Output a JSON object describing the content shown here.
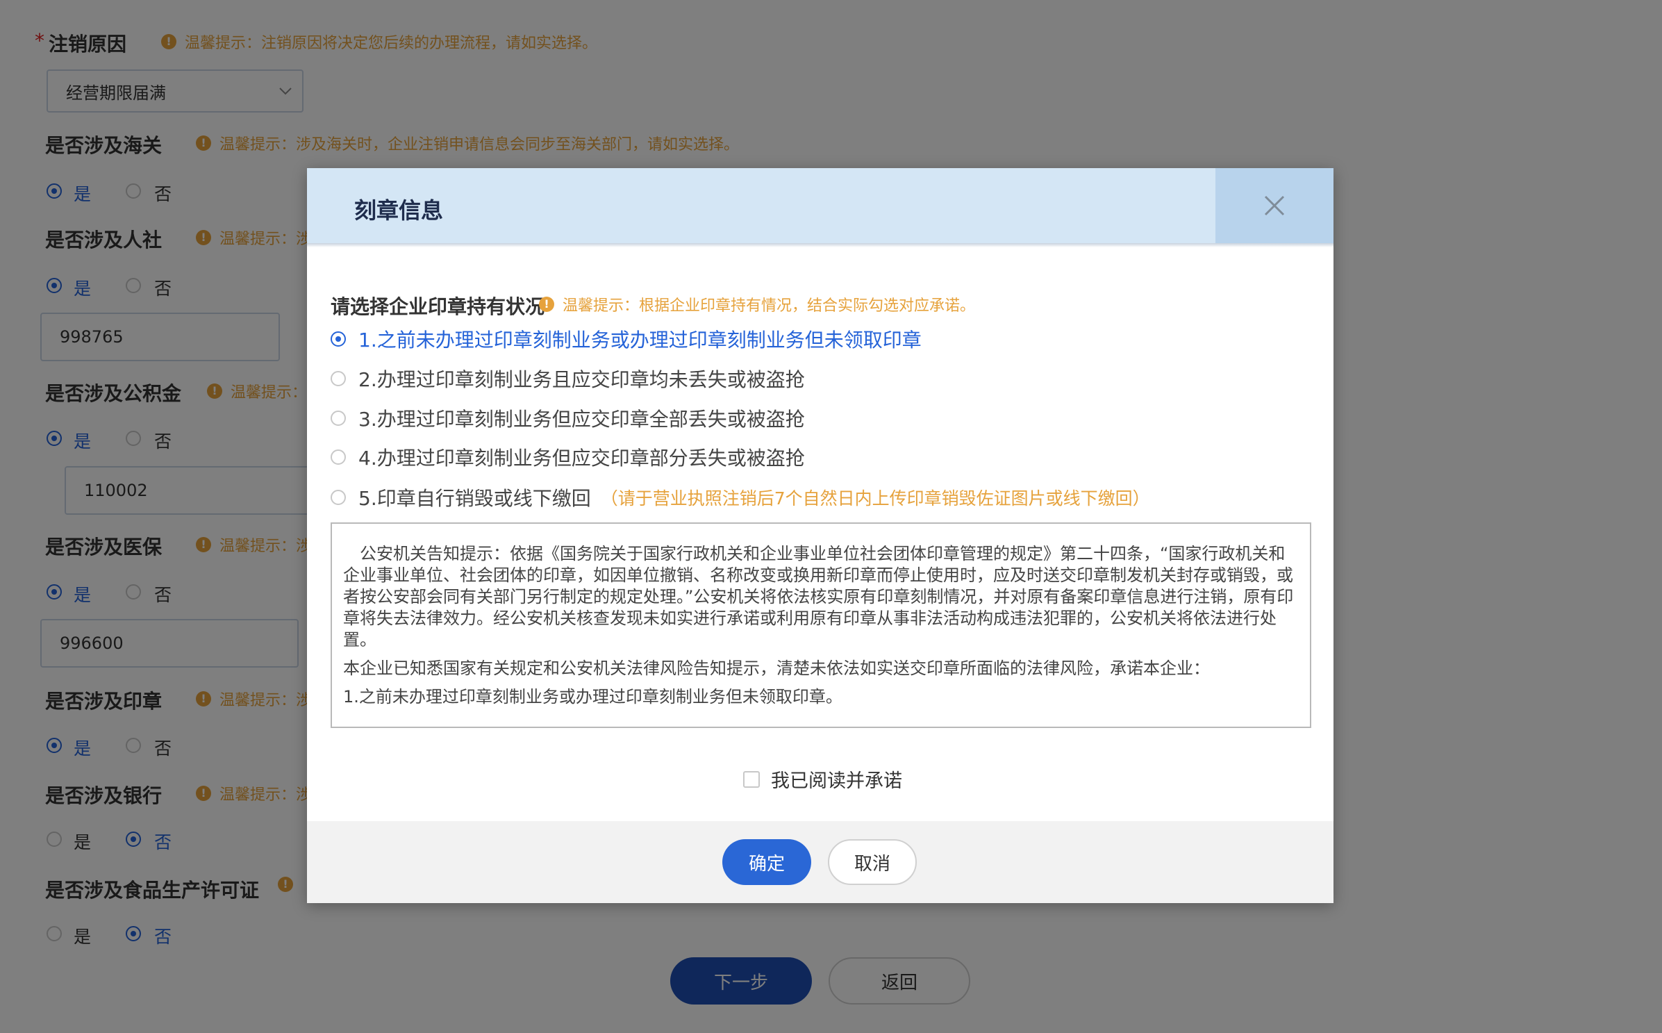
{
  "form": {
    "cancel_reason": {
      "label": "注销原因",
      "required_mark": "*",
      "tip": "温馨提示：注销原因将决定您后续的办理流程，请如实选择。",
      "value": "经营期限届满"
    },
    "customs": {
      "label": "是否涉及海关",
      "tip": "温馨提示：涉及海关时，企业注销申请信息会同步至海关部门，请如实选择。",
      "yes": "是",
      "no": "否"
    },
    "social": {
      "label": "是否涉及人社",
      "tip": "温馨提示：涉",
      "yes": "是",
      "no": "否",
      "input_value": "998765"
    },
    "fund": {
      "label": "是否涉及公积金",
      "tip": "温馨提示：",
      "yes": "是",
      "no": "否",
      "input_value": "110002"
    },
    "medical": {
      "label": "是否涉及医保",
      "tip": "温馨提示：涉",
      "yes": "是",
      "no": "否",
      "input_value": "996600"
    },
    "seal": {
      "label": "是否涉及印章",
      "tip": "温馨提示：涉",
      "yes": "是",
      "no": "否"
    },
    "bank": {
      "label": "是否涉及银行",
      "tip": "温馨提示：涉",
      "yes": "是",
      "no": "否"
    },
    "food": {
      "label": "是否涉及食品生产许可证",
      "yes": "是",
      "no": "否"
    },
    "next_button": "下一步",
    "back_button": "返回"
  },
  "modal": {
    "title": "刻章信息",
    "section_label": "请选择企业印章持有状况",
    "section_tip": "温馨提示：根据企业印章持有情况，结合实际勾选对应承诺。",
    "options": [
      {
        "label": "1.之前未办理过印章刻制业务或办理过印章刻制业务但未领取印章",
        "selected": true
      },
      {
        "label": "2.办理过印章刻制业务且应交印章均未丢失或被盗抢",
        "selected": false
      },
      {
        "label": "3.办理过印章刻制业务但应交印章全部丢失或被盗抢",
        "selected": false
      },
      {
        "label": "4.办理过印章刻制业务但应交印章部分丢失或被盗抢",
        "selected": false
      },
      {
        "label": "5.印章自行销毁或线下缴回",
        "note": "（请于营业执照注销后7个自然日内上传印章销毁佐证图片或线下缴回）",
        "selected": false
      }
    ],
    "notice": {
      "p1": "公安机关告知提示：依据《国务院关于国家行政机关和企业事业单位社会团体印章管理的规定》第二十四条，“国家行政机关和企业事业单位、社会团体的印章，如因单位撤销、名称改变或换用新印章而停止使用时，应及时送交印章制发机关封存或销毁，或者按公安部会同有关部门另行制定的规定处理。”公安机关将依法核实原有印章刻制情况，并对原有备案印章信息进行注销，原有印章将失去法律效力。经公安机关核查发现未如实进行承诺或利用原有印章从事非法活动构成违法犯罪的，公安机关将依法进行处置。",
      "p2": "本企业已知悉国家有关规定和公安机关法律风险告知提示，清楚未依法如实送交印章所面临的法律风险，承诺本企业：",
      "p3": "1.之前未办理过印章刻制业务或办理过印章刻制业务但未领取印章。"
    },
    "agree_label": "我已阅读并承诺",
    "confirm_button": "确定",
    "cancel_button": "取消"
  },
  "colors": {
    "accent": "#2563d8",
    "warning": "#e6a23c",
    "primary_button": "#1e4fb4",
    "modal_header": "#d4e6f5"
  }
}
